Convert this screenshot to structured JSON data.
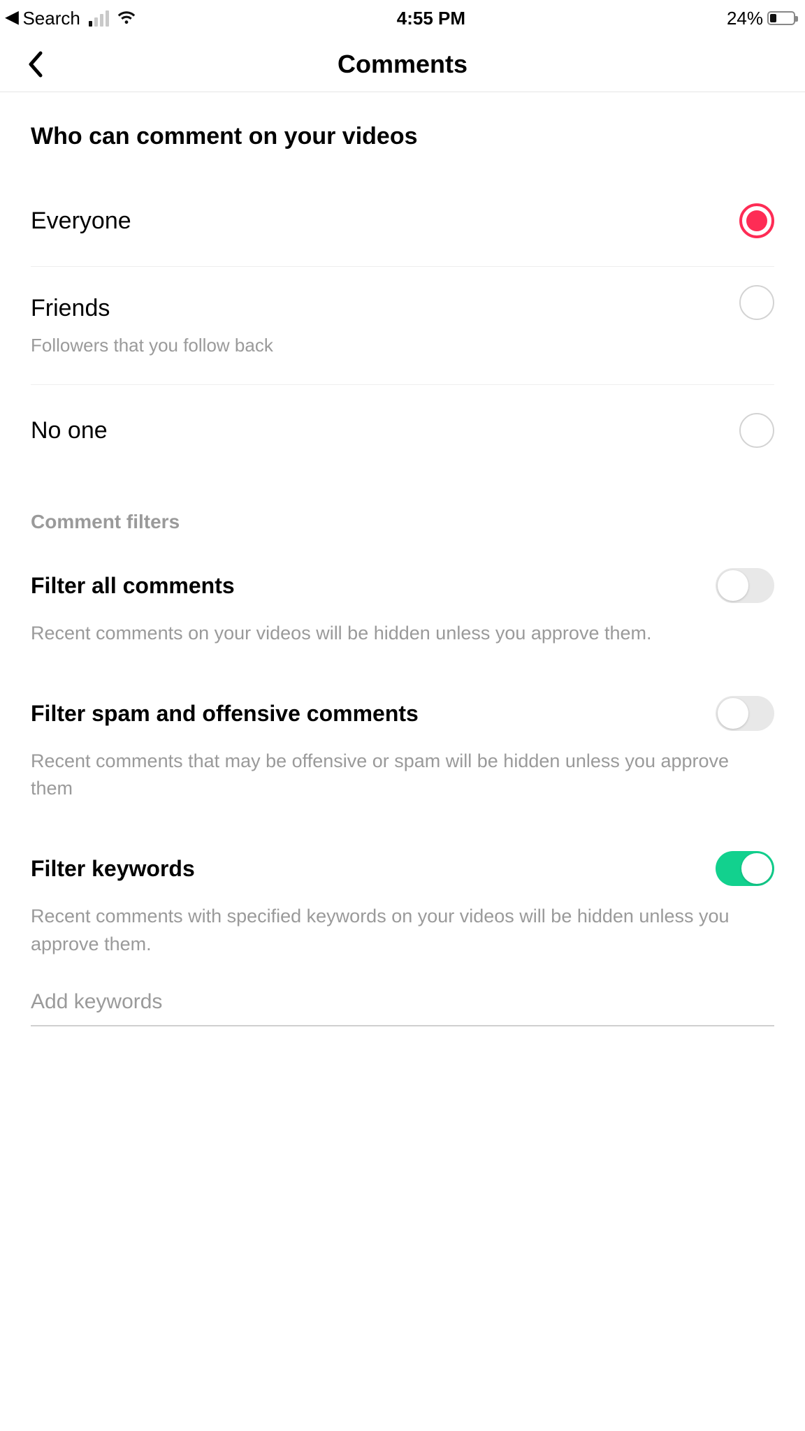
{
  "status_bar": {
    "back_app": "Search",
    "time": "4:55 PM",
    "battery_percent": "24%"
  },
  "header": {
    "title": "Comments"
  },
  "who_can_comment": {
    "title": "Who can comment on your videos",
    "options": [
      {
        "label": "Everyone",
        "sub": "",
        "selected": true
      },
      {
        "label": "Friends",
        "sub": "Followers that you follow back",
        "selected": false
      },
      {
        "label": "No one",
        "sub": "",
        "selected": false
      }
    ]
  },
  "filters": {
    "header": "Comment filters",
    "items": [
      {
        "label": "Filter all comments",
        "desc": "Recent comments on your videos will be hidden unless you approve them.",
        "on": false
      },
      {
        "label": "Filter spam and offensive comments",
        "desc": "Recent comments that may be offensive or spam will be hidden unless you approve them",
        "on": false
      },
      {
        "label": "Filter keywords",
        "desc": "Recent comments with specified keywords on your videos will be hidden unless you approve them.",
        "on": true
      }
    ]
  },
  "keywords_input": {
    "placeholder": "Add keywords"
  },
  "colors": {
    "accent_pink": "#fe2c55",
    "accent_green": "#12d18e"
  }
}
